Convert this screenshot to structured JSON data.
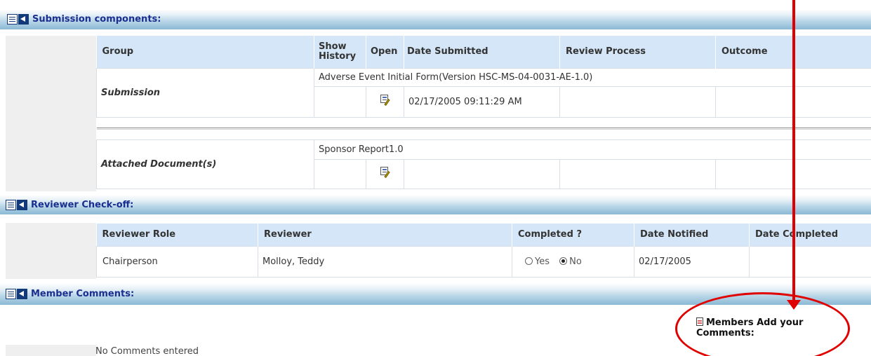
{
  "sections": {
    "submission": {
      "title": "Submission components:"
    },
    "checkoff": {
      "title": "Reviewer Check-off:"
    },
    "comments": {
      "title": "Member Comments:"
    }
  },
  "submission_table": {
    "headers": {
      "group": "Group",
      "history_line1": "Show",
      "history_line2": "History",
      "open": "Open",
      "date_submitted": "Date Submitted",
      "review_process": "Review Process",
      "outcome": "Outcome"
    },
    "submission": {
      "label": "Submission",
      "form_name": "Adverse Event Initial Form(Version HSC-MS-04-0031-AE-1.0)",
      "date_submitted": "02/17/2005 09:11:29 AM"
    },
    "attached": {
      "label": "Attached Document(s)",
      "doc_name": "Sponsor Report1.0"
    }
  },
  "checkoff_table": {
    "headers": {
      "role": "Reviewer Role",
      "reviewer": "Reviewer",
      "completed": "Completed ?",
      "date_notified": "Date Notified",
      "date_completed": "Date Completed"
    },
    "rows": [
      {
        "role": "Chairperson",
        "reviewer": "Molloy, Teddy",
        "yes_label": "Yes",
        "no_label": "No",
        "selected": "No",
        "date_notified": "02/17/2005",
        "date_completed": ""
      }
    ]
  },
  "comments": {
    "add_label_line1": "Members Add your",
    "add_label_line2": "Comments:",
    "empty_text": "No Comments entered"
  },
  "colors": {
    "annotation": "#e00000",
    "header_text": "#1a2f8f",
    "highlight_row": "#ffffcc"
  }
}
